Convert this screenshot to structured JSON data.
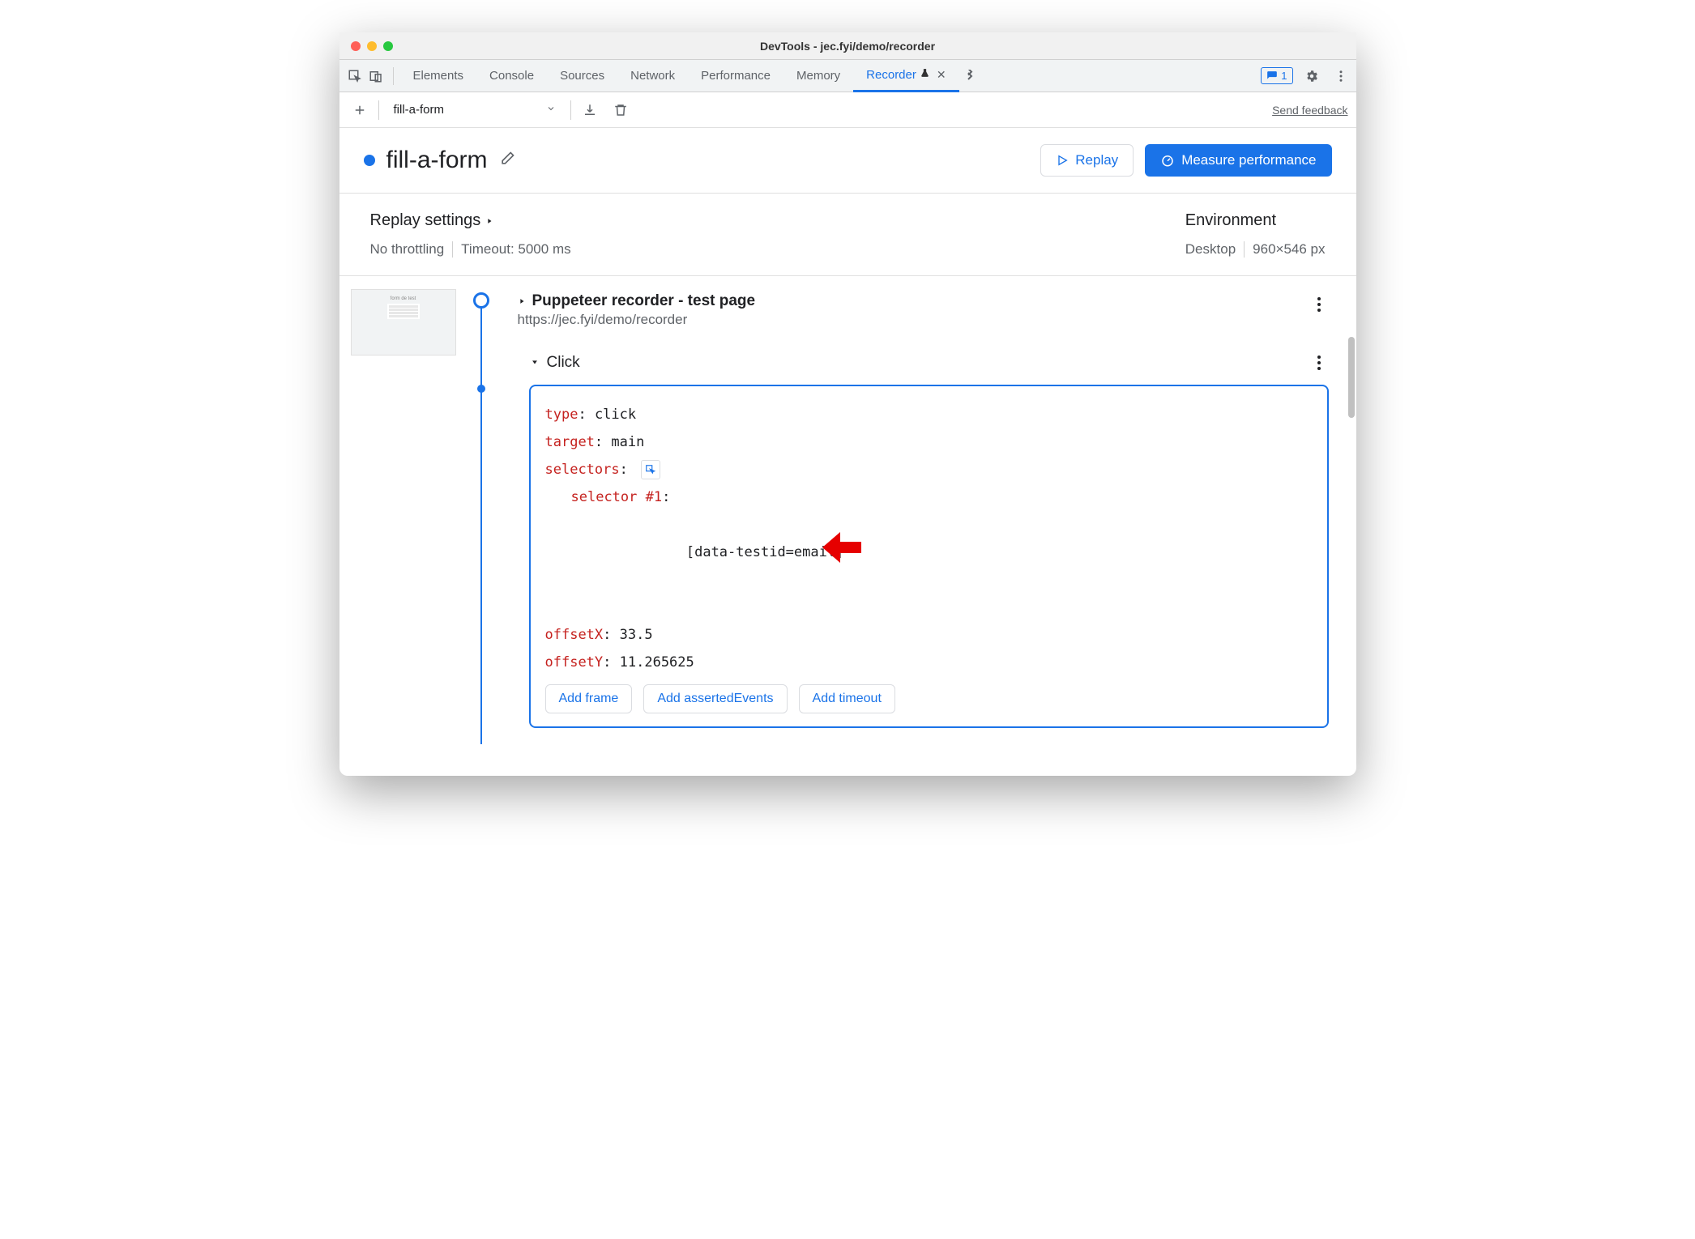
{
  "window": {
    "title": "DevTools - jec.fyi/demo/recorder"
  },
  "tabs": {
    "items": [
      "Elements",
      "Console",
      "Sources",
      "Network",
      "Performance",
      "Memory"
    ],
    "active": "Recorder",
    "issues_count": "1"
  },
  "toolbar": {
    "recording_name": "fill-a-form",
    "feedback": "Send feedback"
  },
  "header": {
    "title": "fill-a-form",
    "replay": "Replay",
    "measure": "Measure performance"
  },
  "settings": {
    "replay_title": "Replay settings",
    "throttle": "No throttling",
    "timeout": "Timeout: 5000 ms",
    "env_title": "Environment",
    "env_device": "Desktop",
    "env_viewport": "960×546 px"
  },
  "steps": {
    "initial": {
      "title": "Puppeteer recorder - test page",
      "url": "https://jec.fyi/demo/recorder"
    },
    "click": {
      "label": "Click",
      "type_key": "type",
      "type_val": "click",
      "target_key": "target",
      "target_val": "main",
      "selectors_key": "selectors",
      "selector_n_key": "selector #1",
      "selector_val": "[data-testid=email]",
      "offsetx_key": "offsetX",
      "offsetx_val": "33.5",
      "offsety_key": "offsetY",
      "offsety_val": "11.265625",
      "add_frame": "Add frame",
      "add_asserted": "Add assertedEvents",
      "add_timeout": "Add timeout"
    }
  }
}
